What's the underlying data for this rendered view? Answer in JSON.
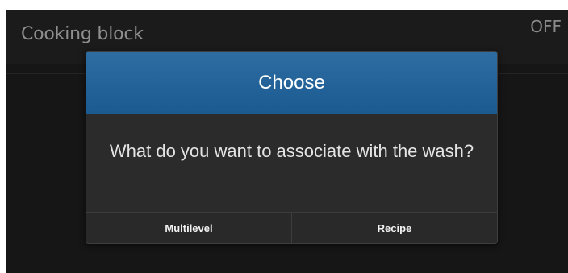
{
  "background": {
    "row_title": "Cooking block",
    "toggle_state": "OFF"
  },
  "dialog": {
    "title": "Choose",
    "message": "What do you want to associate with the wash?",
    "buttons": [
      {
        "label": "Multilevel"
      },
      {
        "label": "Recipe"
      }
    ]
  },
  "colors": {
    "header_blue": "#1f6198",
    "screen_bg": "#161616",
    "dialog_bg": "#2b2b2b"
  }
}
